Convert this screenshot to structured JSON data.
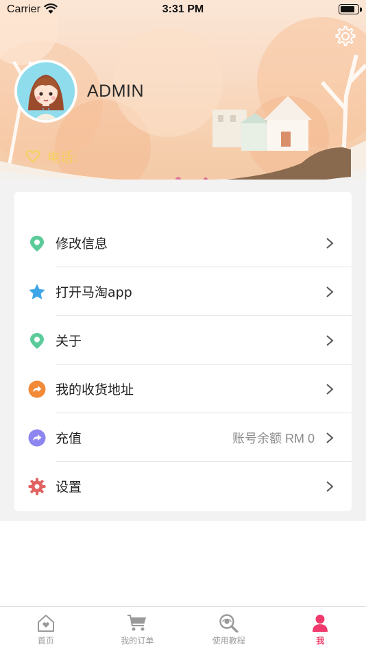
{
  "status_bar": {
    "carrier": "Carrier",
    "time": "3:31 PM"
  },
  "profile": {
    "username": "ADMIN",
    "phone_label": "电话:"
  },
  "menu": [
    {
      "label": "修改信息",
      "icon": "location-pin-icon",
      "color": "#5ccb9a",
      "value": ""
    },
    {
      "label": "打开马淘app",
      "icon": "star-icon",
      "color": "#3ea6e8",
      "value": ""
    },
    {
      "label": "关于",
      "icon": "location-pin-icon",
      "color": "#5ccb9a",
      "value": ""
    },
    {
      "label": "我的收货地址",
      "icon": "share-arrow-icon",
      "color": "#f28a38",
      "value": ""
    },
    {
      "label": "充值",
      "icon": "share-arrow-icon",
      "color": "#8e86f0",
      "value": "账号余额 RM 0"
    },
    {
      "label": "设置",
      "icon": "gear-icon",
      "color": "#e26262",
      "value": ""
    }
  ],
  "tabbar": [
    {
      "label": "首页",
      "icon": "home-heart-icon",
      "active": false
    },
    {
      "label": "我的订单",
      "icon": "cart-icon",
      "active": false
    },
    {
      "label": "使用教程",
      "icon": "eye-search-icon",
      "active": false
    },
    {
      "label": "我",
      "icon": "person-icon",
      "active": true
    }
  ],
  "colors": {
    "accent": "#f03a6c",
    "phone_label": "#f4d15b",
    "inactive_tab": "#9a9a9a"
  }
}
